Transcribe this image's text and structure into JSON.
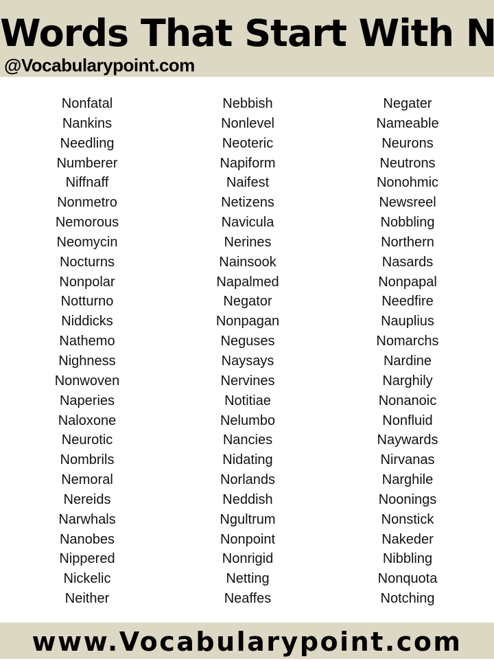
{
  "header": {
    "title": "Words That Start With N",
    "handle": "@Vocabularypoint.com"
  },
  "columns": [
    {
      "words": [
        "Nonfatal",
        "Nankins",
        "Needling",
        "Numberer",
        "Niffnaff",
        "Nonmetro",
        "Nemorous",
        "Neomycin",
        "Nocturns",
        "Nonpolar",
        "Notturno",
        "Niddicks",
        "Nathemo",
        "Nighness",
        "Nonwoven",
        "Naperies",
        "Naloxone",
        "Neurotic",
        "Nombrils",
        "Nemoral",
        "Nereids",
        "Narwhals",
        "Nanobes",
        "Nippered",
        "Nickelic",
        "Neither"
      ]
    },
    {
      "words": [
        "Nebbish",
        "Nonlevel",
        "Neoteric",
        "Napiform",
        "Naifest",
        "Netizens",
        "Navicula",
        "Nerines",
        "Nainsook",
        "Napalmed",
        "Negator",
        "Nonpagan",
        "Neguses",
        "Naysays",
        "Nervines",
        "Notitiae",
        "Nelumbo",
        "Nancies",
        "Nidating",
        "Norlands",
        "Neddish",
        "Ngultrum",
        "Nonpoint",
        "Nonrigid",
        "Netting",
        "Neaffes"
      ]
    },
    {
      "words": [
        "Negater",
        "Nameable",
        "Neurons",
        "Neutrons",
        "Nonohmic",
        "Newsreel",
        "Nobbling",
        "Northern",
        "Nasards",
        "Nonpapal",
        "Needfire",
        "Nauplius",
        "Nomarchs",
        "Nardine",
        "Narghily",
        "Nonanoic",
        "Nonfluid",
        "Naywards",
        "Nirvanas",
        "Narghile",
        "Noonings",
        "Nonstick",
        "Nakeder",
        "Nibbling",
        "Nonquota",
        "Notching"
      ]
    }
  ],
  "footer": {
    "url": "www.Vocabularypoint.com"
  },
  "colors": {
    "band_background": "#DDD8C4",
    "text": "#111111"
  }
}
